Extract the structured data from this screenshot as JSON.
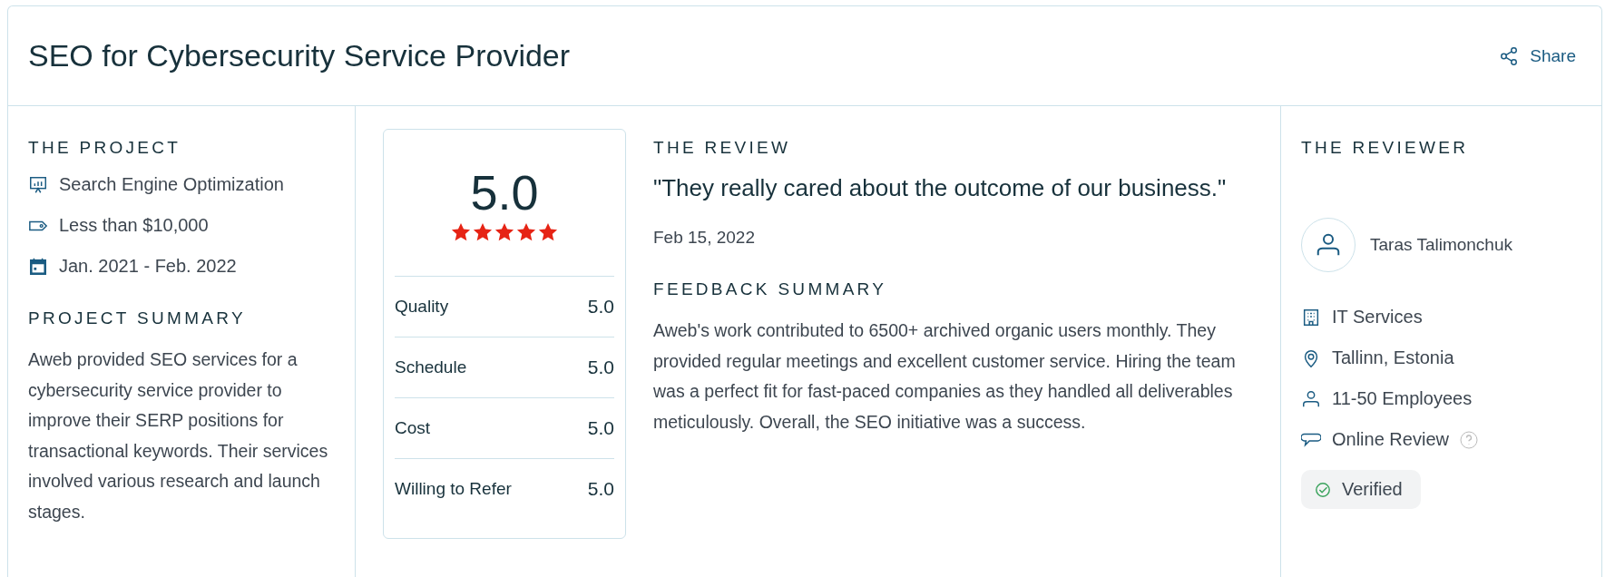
{
  "header": {
    "title": "SEO for Cybersecurity Service Provider",
    "share_label": "Share"
  },
  "project": {
    "heading": "THE PROJECT",
    "facts": [
      {
        "kind": "service",
        "text": "Search Engine Optimization"
      },
      {
        "kind": "budget",
        "text": "Less than $10,000"
      },
      {
        "kind": "dates",
        "text": "Jan. 2021 - Feb. 2022"
      }
    ],
    "summary_heading": "PROJECT SUMMARY",
    "summary": "Aweb provided SEO services for a cybersecurity service provider to improve their SERP positions for transactional keywords. Their services involved various research and launch stages."
  },
  "rating": {
    "overall": "5.0",
    "stars": 5,
    "scores": [
      {
        "label": "Quality",
        "value": "5.0"
      },
      {
        "label": "Schedule",
        "value": "5.0"
      },
      {
        "label": "Cost",
        "value": "5.0"
      },
      {
        "label": "Willing to Refer",
        "value": "5.0"
      }
    ]
  },
  "review": {
    "heading": "THE REVIEW",
    "quote": "\"They really cared about the outcome of our business.\"",
    "date": "Feb 15, 2022",
    "feedback_heading": "FEEDBACK SUMMARY",
    "feedback": "Aweb's work contributed to 6500+ archived organic users monthly. They provided regular meetings and excellent customer service. Hiring the team was a perfect fit for fast-paced companies as they handled all deliverables meticulously. Overall, the SEO initiative was a success."
  },
  "reviewer": {
    "heading": "THE REVIEWER",
    "name": "Taras Talimonchuk",
    "facts": [
      {
        "kind": "industry",
        "text": "IT Services"
      },
      {
        "kind": "location",
        "text": "Tallinn, Estonia"
      },
      {
        "kind": "size",
        "text": "11-50 Employees"
      },
      {
        "kind": "source",
        "text": "Online Review",
        "help": true
      }
    ],
    "verified": true,
    "verified_label": "Verified"
  }
}
